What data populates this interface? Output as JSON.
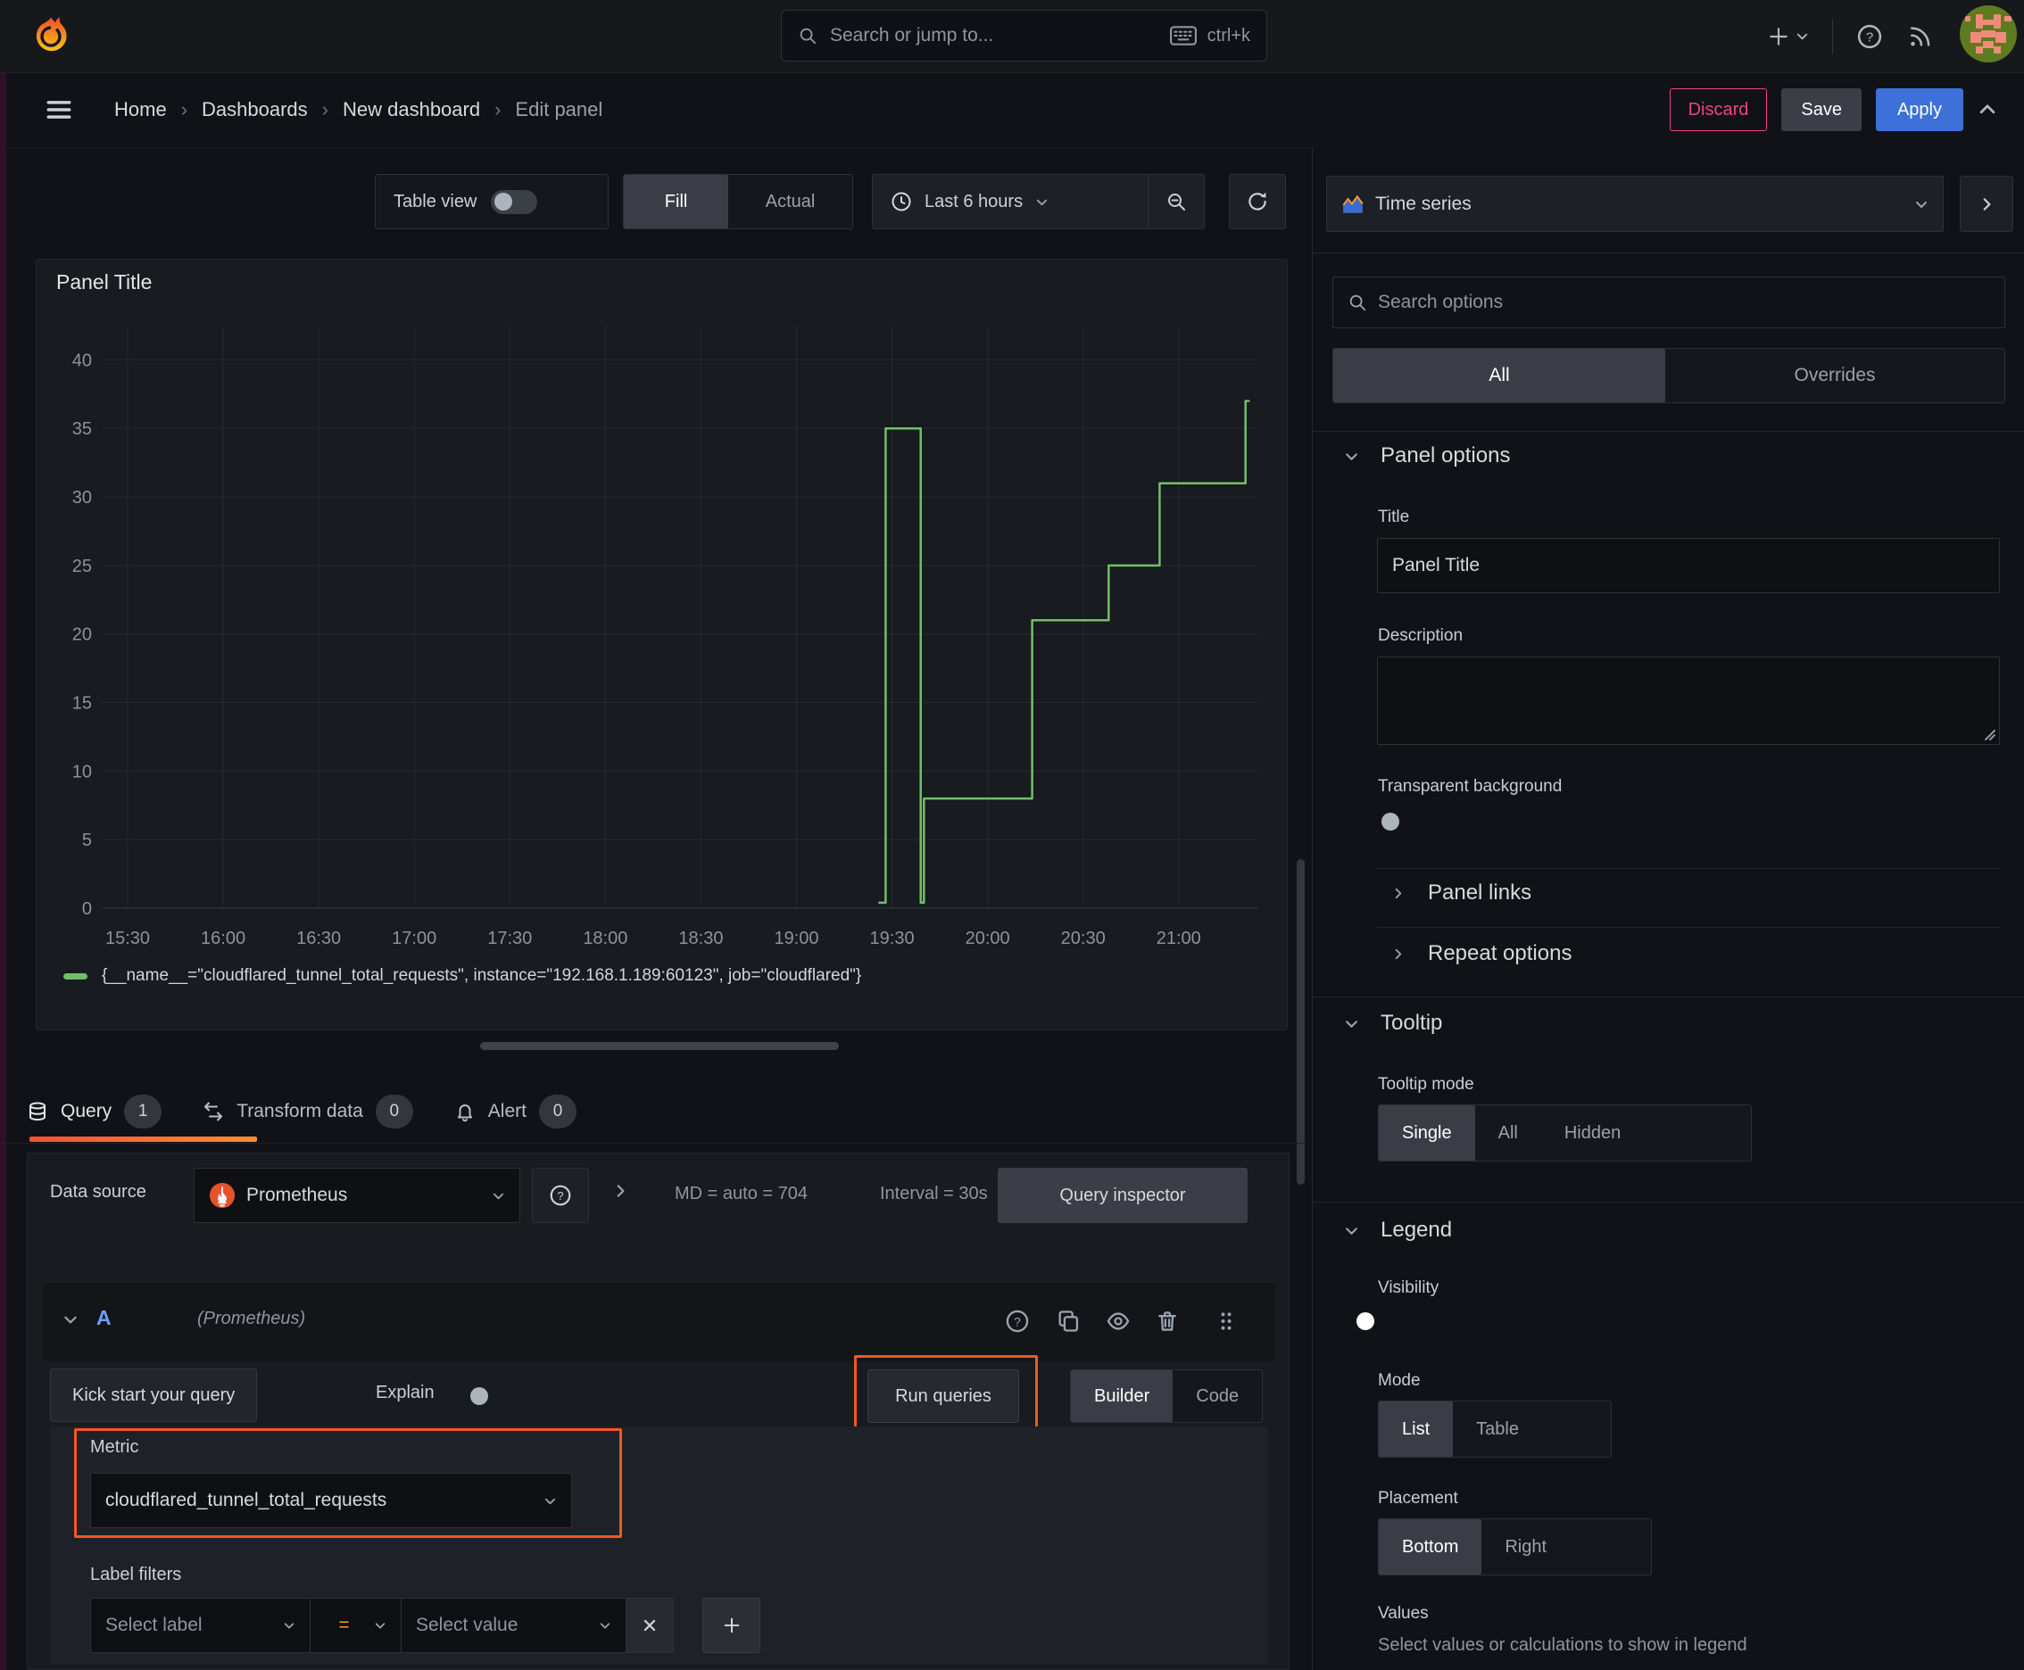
{
  "topnav": {
    "search_placeholder": "Search or jump to...",
    "search_shortcut": "ctrl+k"
  },
  "breadcrumb": {
    "items": [
      "Home",
      "Dashboards",
      "New dashboard",
      "Edit panel"
    ],
    "discard": "Discard",
    "save": "Save",
    "apply": "Apply"
  },
  "toolbar": {
    "table_view": "Table view",
    "fill": "Fill",
    "actual": "Actual",
    "time_range": "Last 6 hours"
  },
  "panel": {
    "title": "Panel Title",
    "legend_series": "{__name__=\"cloudflared_tunnel_total_requests\", instance=\"192.168.1.189:60123\", job=\"cloudflared\"}"
  },
  "chart_data": {
    "type": "line",
    "title": "Panel Title",
    "style": "step-after",
    "x_ticks": [
      "15:30",
      "16:00",
      "16:30",
      "17:00",
      "17:30",
      "18:00",
      "18:30",
      "19:00",
      "19:30",
      "20:00",
      "20:30",
      "21:00"
    ],
    "x_domain_minutes": [
      0,
      355
    ],
    "y_ticks": [
      0,
      5,
      10,
      15,
      20,
      25,
      30,
      35,
      40
    ],
    "ylim": [
      0,
      42.5
    ],
    "grid": true,
    "legend_position": "bottom",
    "series": [
      {
        "name": "{__name__=\"cloudflared_tunnel_total_requests\", instance=\"192.168.1.189:60123\", job=\"cloudflared\"}",
        "color": "#73bf69",
        "points": [
          [
            236,
            0.4
          ],
          [
            238,
            0.4
          ],
          [
            238,
            35
          ],
          [
            249,
            35
          ],
          [
            249,
            0.4
          ],
          [
            250,
            0.4
          ],
          [
            250,
            8
          ],
          [
            284,
            8
          ],
          [
            284,
            21
          ],
          [
            308,
            21
          ],
          [
            308,
            25
          ],
          [
            324,
            25
          ],
          [
            324,
            31
          ],
          [
            351,
            31
          ],
          [
            351,
            37
          ],
          [
            352,
            37
          ]
        ]
      }
    ]
  },
  "tabs": {
    "query": "Query",
    "query_count": "1",
    "transform": "Transform data",
    "transform_count": "0",
    "alert": "Alert",
    "alert_count": "0"
  },
  "qe": {
    "datasource_label": "Data source",
    "datasource": "Prometheus",
    "md_stat": "MD = auto = 704",
    "interval_stat": "Interval = 30s",
    "inspector": "Query inspector",
    "ref_id": "A",
    "ref_ds": "(Prometheus)",
    "kick_start": "Kick start your query",
    "explain": "Explain",
    "run_queries": "Run queries",
    "builder": "Builder",
    "code": "Code",
    "metric_label": "Metric",
    "metric_value": "cloudflared_tunnel_total_requests",
    "filters_label": "Label filters",
    "select_label": "Select label",
    "operator": "=",
    "select_value": "Select value"
  },
  "sb": {
    "viz": "Time series",
    "search_placeholder": "Search options",
    "all": "All",
    "overrides": "Overrides",
    "po_header": "Panel options",
    "title_label": "Title",
    "title_value": "Panel Title",
    "desc_label": "Description",
    "transparent_label": "Transparent background",
    "links": "Panel links",
    "repeat": "Repeat options",
    "tt_header": "Tooltip",
    "tt_mode_label": "Tooltip mode",
    "tt_single": "Single",
    "tt_all": "All",
    "tt_hidden": "Hidden",
    "lg_header": "Legend",
    "lg_visibility": "Visibility",
    "lg_mode": "Mode",
    "lg_list": "List",
    "lg_table": "Table",
    "lg_placement": "Placement",
    "lg_bottom": "Bottom",
    "lg_right": "Right",
    "lg_values": "Values",
    "lg_values_hint": "Select values or calculations to show in legend"
  },
  "colors": {
    "accent_blue": "#3d71d9",
    "annotation_orange": "#f25822",
    "series_green": "#73bf69",
    "discard_pink": "#f0437c",
    "tab_underline_start": "#f0542e",
    "tab_underline_end": "#ff8c33"
  }
}
